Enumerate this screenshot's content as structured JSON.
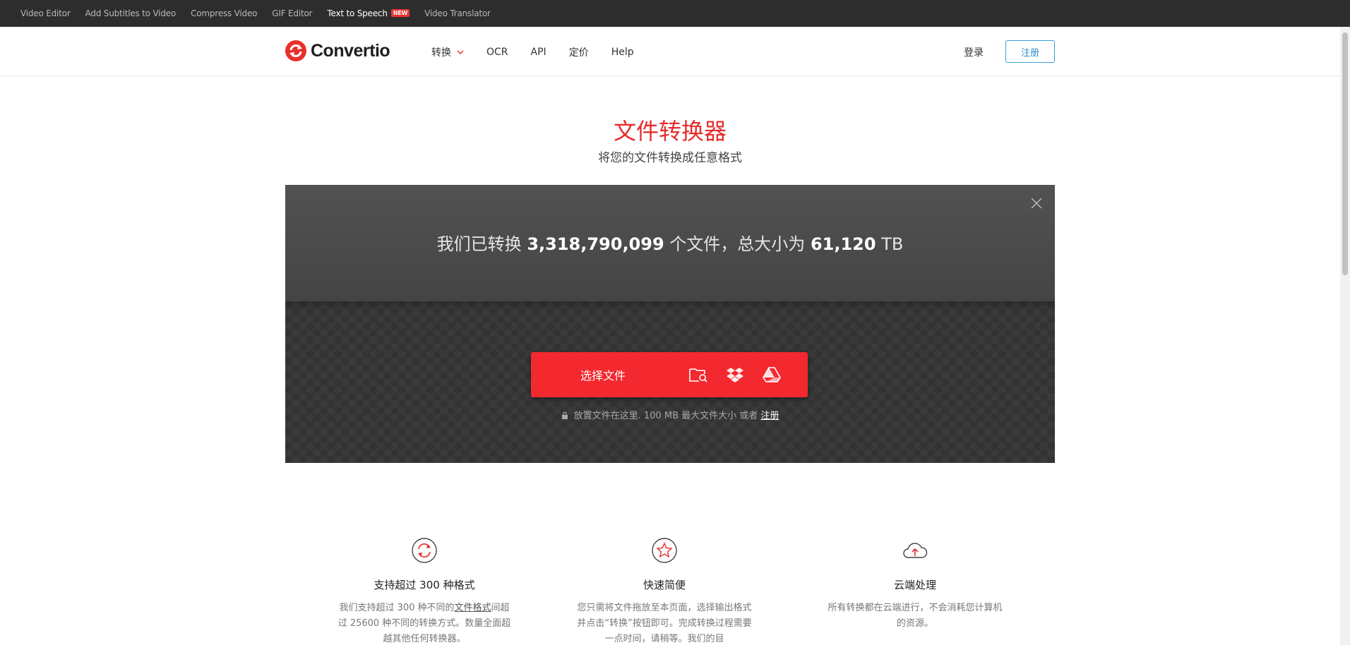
{
  "topbar": {
    "links": [
      "Video Editor",
      "Add Subtitles to Video",
      "Compress Video",
      "GIF Editor",
      "Text to Speech",
      "Video Translator"
    ],
    "new_badge": "NEW"
  },
  "header": {
    "logo": "Convertio",
    "nav": [
      "转换",
      "OCR",
      "API",
      "定价",
      "Help"
    ],
    "login": "登录",
    "signup": "注册"
  },
  "hero": {
    "title": "文件转换器",
    "subtitle": "将您的文件转换成任意格式"
  },
  "panel": {
    "stats_prefix": "我们已转换",
    "files_count": "3,318,790,099",
    "stats_middle": "个文件，总大小为",
    "total_size": "61,120",
    "size_unit": "TB",
    "choose_label": "选择文件",
    "drop_hint": "放置文件在这里. 100 MB 最大文件大小 或者",
    "drop_link": "注册"
  },
  "features": [
    {
      "title": "支持超过 300 种格式",
      "desc_pre": "我们支持超过 300 种不同的",
      "desc_link": "文件格式",
      "desc_post": "间超过 25600 种不同的转换方式。数量全面超越其他任何转换器。"
    },
    {
      "title": "快速简便",
      "desc": "您只需将文件拖放至本页面，选择输出格式并点击“转换”按钮即可。完成转换过程需要一点时间，请稍等。我们的目"
    },
    {
      "title": "云端处理",
      "desc": "所有转换都在云端进行，不会消耗您计算机的资源。"
    }
  ],
  "colors": {
    "brand_red": "#f3292f",
    "title_red": "#e62c2c",
    "signup_blue": "#2f8fca"
  }
}
